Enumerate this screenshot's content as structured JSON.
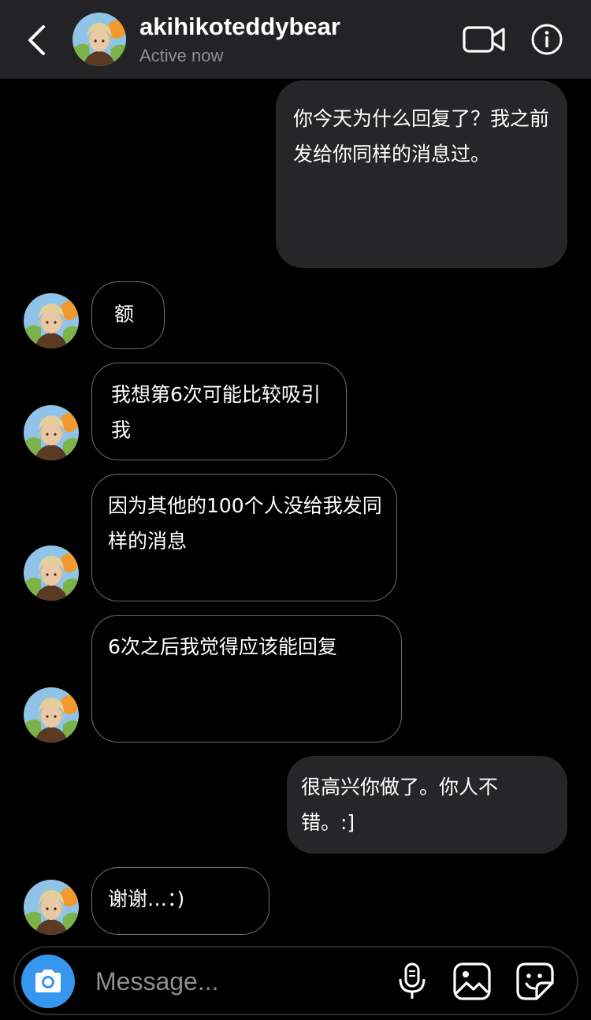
{
  "header": {
    "username": "akihikoteddybear",
    "status": "Active now"
  },
  "messages": [
    {
      "direction": "sent",
      "text": "你今天为什么回复了？我之前发给你同样的消息过。"
    },
    {
      "direction": "received",
      "text": "额"
    },
    {
      "direction": "received",
      "text": "我想第6次可能比较吸引我"
    },
    {
      "direction": "received",
      "text": "因为其他的100个人没给我发同样的消息"
    },
    {
      "direction": "received",
      "text": "6次之后我觉得应该能回复"
    },
    {
      "direction": "sent",
      "text": "很高兴你做了。你人不错。:]"
    },
    {
      "direction": "received",
      "text": "谢谢…：)"
    }
  ],
  "composer": {
    "placeholder": "Message..."
  },
  "colors": {
    "header_bg": "#232325",
    "sent_bubble": "#262628",
    "received_border": "#6e6e72",
    "camera_button": "#3797f0",
    "secondary_text": "#8e8e93"
  },
  "icons": [
    "back-chevron-icon",
    "video-call-icon",
    "info-icon",
    "camera-icon",
    "microphone-icon",
    "gallery-icon",
    "sticker-icon"
  ]
}
